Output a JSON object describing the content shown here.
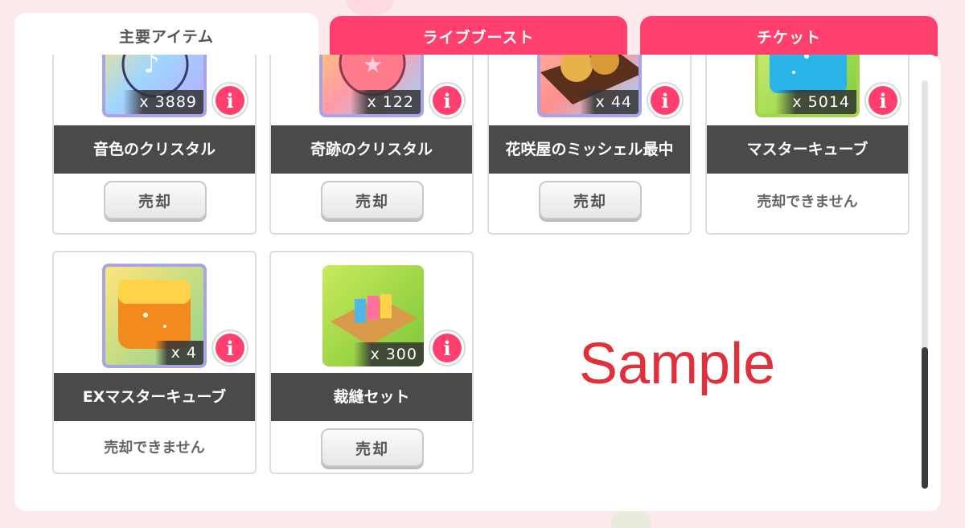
{
  "tabs": [
    {
      "label": "主要アイテム",
      "active": true
    },
    {
      "label": "ライブブースト",
      "active": false
    },
    {
      "label": "チケット",
      "active": false
    }
  ],
  "info_icon_glyph": "i",
  "items": [
    {
      "name": "音色のクリスタル",
      "count": "x 3889",
      "sell": "売却",
      "icon": "blue-crystal-icon"
    },
    {
      "name": "奇跡のクリスタル",
      "count": "x 122",
      "sell": "売却",
      "icon": "pink-star-crystal-icon"
    },
    {
      "name": "花咲屋のミッシェル最中",
      "count": "x 44",
      "sell": "売却",
      "icon": "monaka-sweets-icon"
    },
    {
      "name": "マスターキューブ",
      "count": "x 5014",
      "status": "売却できません",
      "icon": "blue-cube-icon"
    },
    {
      "name": "EXマスターキューブ",
      "count": "x 4",
      "status": "売却できません",
      "icon": "orange-cube-icon"
    },
    {
      "name": "裁縫セット",
      "count": "x 300",
      "sell": "売却",
      "icon": "sewing-kit-icon"
    }
  ],
  "watermark": "Sample",
  "colors": {
    "accent": "#ff3f6e",
    "background": "#fbe9ec",
    "name_bar": "#4a4a4a"
  }
}
